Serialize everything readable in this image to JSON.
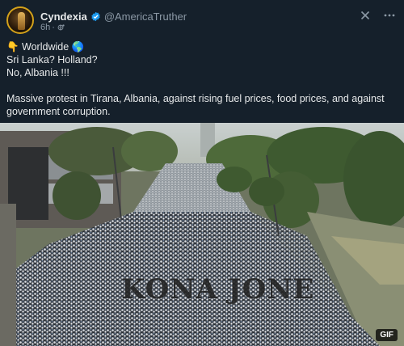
{
  "post": {
    "author": {
      "display_name": "Cyndexia",
      "handle": "@AmericaTruther",
      "verified": true
    },
    "time": "6h",
    "icons": {
      "avatar": "avatar-image",
      "verified": "verified-badge-icon",
      "audience": "globe-icon",
      "close": "close-icon",
      "more": "more-icon"
    },
    "text": {
      "line1": "👇 Worldwide 🌎",
      "line2": "Sri Lanka? Holland?",
      "line3": "No, Albania !!!",
      "paragraph": "Massive protest in Tirana, Albania, against rising fuel prices, food prices, and against government corruption."
    },
    "media": {
      "badge": "GIF",
      "watermark": "KONA JONE"
    },
    "colors": {
      "background": "#15202b",
      "verified": "#1d9bf0",
      "secondary_text": "#8b98a5"
    }
  }
}
